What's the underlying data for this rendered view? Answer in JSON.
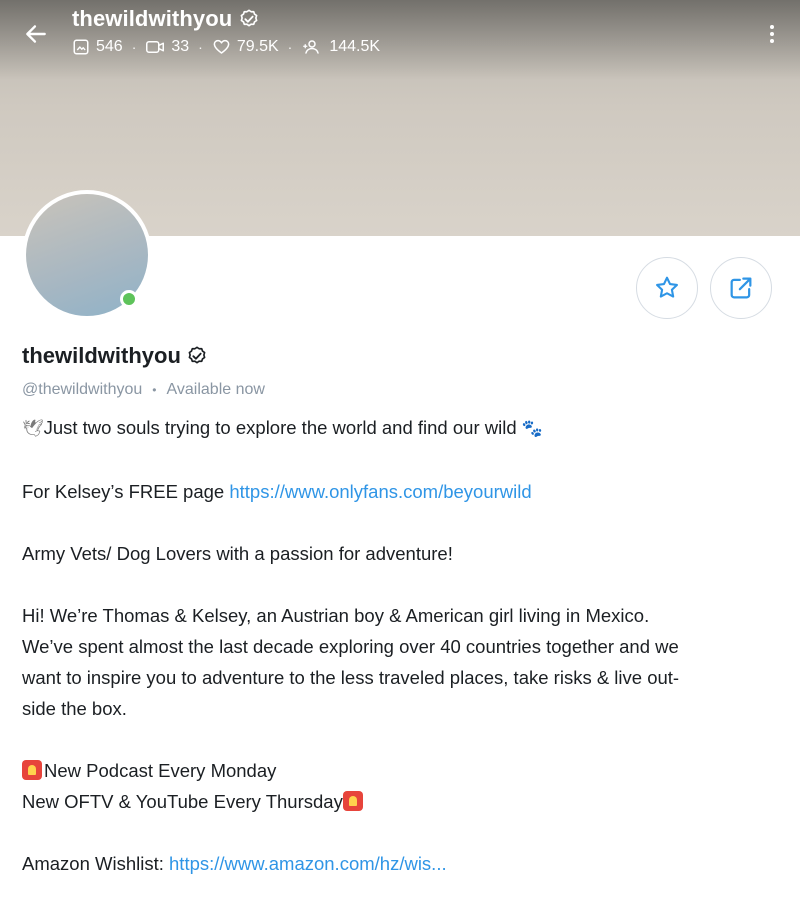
{
  "header": {
    "username": "thewildwithyou",
    "stats": {
      "posts": "546",
      "videos": "33",
      "likes": "79.5K",
      "fans": "144.5K"
    },
    "icons": [
      "back-arrow-icon",
      "verified-badge-icon",
      "photo-icon",
      "video-icon",
      "heart-icon",
      "fans-icon",
      "more-vertical-icon"
    ]
  },
  "actions": {
    "icons": [
      "star-icon",
      "share-icon"
    ]
  },
  "profile": {
    "name": "thewildwithyou",
    "handle": "@thewildwithyou",
    "status": "Available now",
    "online": true
  },
  "bio": {
    "line1_text": "Just two souls trying to explore the world and find our wild",
    "line1_emoji_start": "dove-emoji",
    "line1_emoji_end": "paw-prints-emoji",
    "free_page_prefix": "For Kelsey’s FREE page",
    "free_page_link": "https://www.onlyfans.com/beyourwild",
    "line_vets": "Army Vets/ Dog Lovers with a passion for adventure!",
    "para_line1": "Hi! We’re Thomas & Kelsey, an Austrian boy & American girl living in Mexico.",
    "para_line2": "We’ve spent almost the last decade exploring over 40 countries together and we",
    "para_line3": "want to inspire you to adventure to the less traveled places, take risks & live out-",
    "para_line4": "side the box.",
    "podcast": "New Podcast Every Monday",
    "oftv": "New OFTV & YouTube Every Thursday",
    "wishlist_prefix": "Amazon Wishlist:",
    "wishlist_link": "https://www.amazon.com/hz/wis..."
  },
  "colors": {
    "link": "#2f95e6",
    "muted": "#8a96a3",
    "online": "#5ec35a",
    "action_icon": "#2f95e6"
  }
}
